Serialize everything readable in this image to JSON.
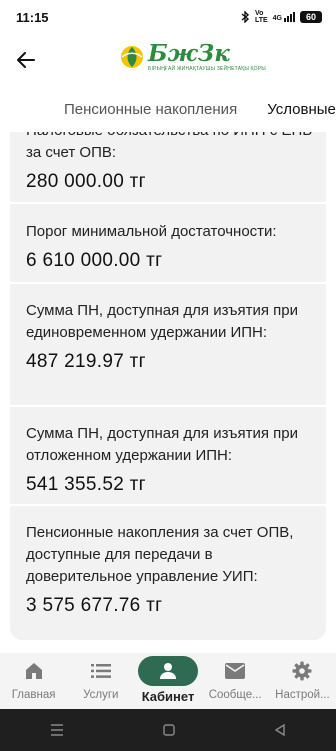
{
  "status_bar": {
    "time": "11:15",
    "network_top": "Vo",
    "network_bottom": "LTE",
    "signal": "4G",
    "battery": "60"
  },
  "app_bar": {
    "logo_title": "БжЗк",
    "logo_subtitle": "БІРЫҢҒАЙ ЖИНАҚТАУШЫ ЗЕЙНЕТАҚЫ ҚОРЫ"
  },
  "tabs": [
    {
      "label": "Пенсионные накопления"
    },
    {
      "label": "Условные"
    }
  ],
  "items": [
    {
      "label": "Налоговые обязательства по ИПН с ЕПВ за счет ОПВ:",
      "value": "280 000.00 тг"
    },
    {
      "label": "Порог минимальной достаточности:",
      "value": "6 610 000.00 тг"
    },
    {
      "label": "Сумма ПН, доступная для изъятия при единовременном удержании ИПН:",
      "value": "487 219.97 тг"
    },
    {
      "label": "Сумма ПН, доступная для изъятия при отложенном удержании ИПН:",
      "value": "541 355.52 тг"
    },
    {
      "label": "Пенсионные накопления за счет ОПВ, доступные для передачи в доверительное управление УИП:",
      "value": "3 575 677.76 тг"
    }
  ],
  "bottom_nav": [
    {
      "label": "Главная",
      "icon": "home-icon"
    },
    {
      "label": "Услуги",
      "icon": "list-icon"
    },
    {
      "label": "Кабинет",
      "icon": "person-icon"
    },
    {
      "label": "Сообще...",
      "icon": "mail-icon"
    },
    {
      "label": "Настрой...",
      "icon": "gear-icon"
    }
  ],
  "colors": {
    "brand_green": "#2e8a3e",
    "active_nav": "#2e6b52",
    "card_bg": "#f2f2f2"
  }
}
